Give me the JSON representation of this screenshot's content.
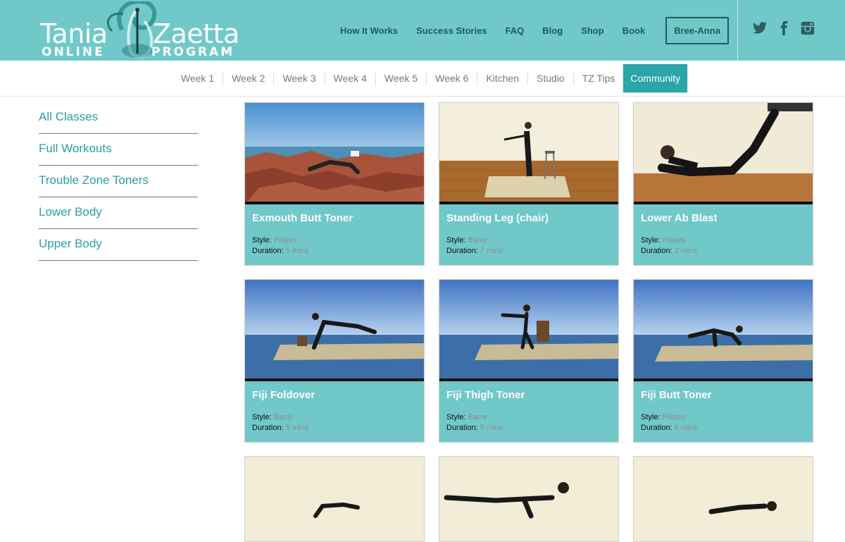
{
  "brand": {
    "line1_left": "Tania",
    "line1_right": "Zaetta",
    "line2_left": "ONLINE",
    "line2_right": "PROGRAM",
    "color": "#70c8c9"
  },
  "main_nav": {
    "items": [
      "How It Works",
      "Success Stories",
      "FAQ",
      "Blog",
      "Shop",
      "Book"
    ],
    "user_button": "Bree-Anna"
  },
  "social": {
    "icons": [
      "twitter-icon",
      "facebook-icon",
      "instagram-icon"
    ]
  },
  "subnav": {
    "items": [
      "Week 1",
      "Week 2",
      "Week 3",
      "Week 4",
      "Week 5",
      "Week 6",
      "Kitchen",
      "Studio",
      "TZ Tips",
      "Community"
    ],
    "active": "Community",
    "active_color": "#2aa5a8"
  },
  "sidebar": {
    "items": [
      "All Classes",
      "Full Workouts",
      "Trouble Zone Toners",
      "Lower Body",
      "Upper Body"
    ]
  },
  "cards": {
    "style_label": "Style:",
    "duration_label": "Duration:",
    "items": [
      {
        "title": "Exmouth Butt Toner",
        "style": "Pilates",
        "duration": "5 mins"
      },
      {
        "title": "Standing Leg (chair)",
        "style": "Barre",
        "duration": "7 mins"
      },
      {
        "title": "Lower Ab Blast",
        "style": "Pilates",
        "duration": "2 mins"
      },
      {
        "title": "Fiji Foldover",
        "style": "Barre",
        "duration": "5 mins"
      },
      {
        "title": "Fiji Thigh Toner",
        "style": "Barre",
        "duration": "5 mins"
      },
      {
        "title": "Fiji Butt Toner",
        "style": "Pilates",
        "duration": "6 mins"
      }
    ]
  }
}
